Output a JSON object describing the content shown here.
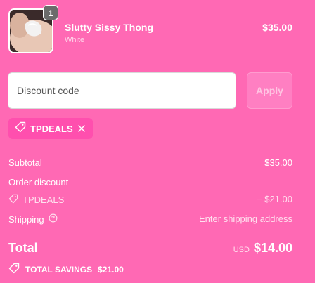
{
  "product": {
    "quantity": "1",
    "name": "Slutty Sissy Thong",
    "variant": "White",
    "price": "$35.00"
  },
  "discount": {
    "placeholder": "Discount code",
    "apply_label": "Apply",
    "applied_code": "TPDEALS"
  },
  "summary": {
    "subtotal_label": "Subtotal",
    "subtotal_value": "$35.00",
    "order_discount_label": "Order discount",
    "discount_code": "TPDEALS",
    "discount_value": "− $21.00",
    "shipping_label": "Shipping",
    "shipping_value": "Enter shipping address",
    "total_label": "Total",
    "currency": "USD",
    "total_value": "$14.00",
    "savings_label": "TOTAL SAVINGS",
    "savings_value": "$21.00"
  },
  "icons": {
    "tag": "tag-icon",
    "close": "close-icon",
    "help": "help-circle-icon"
  },
  "colors": {
    "background": "#FF69B4",
    "chip": "#FF4FAE",
    "text": "#FFFFFF"
  }
}
